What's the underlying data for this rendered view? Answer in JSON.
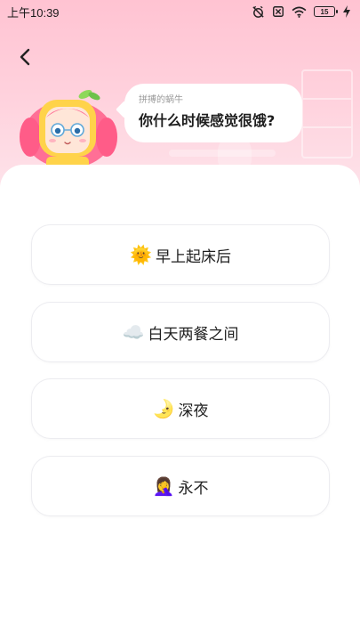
{
  "status_bar": {
    "time": "上午10:39",
    "battery": "15"
  },
  "header": {
    "back_icon": "chevron-left-icon"
  },
  "bubble": {
    "author": "拼搏的蜗牛",
    "question": "你什么时候感觉很饿?"
  },
  "options": [
    {
      "emoji": "🌞",
      "label": "早上起床后"
    },
    {
      "emoji": "☁️",
      "label": "白天两餐之间"
    },
    {
      "emoji": "🌛",
      "label": "深夜"
    },
    {
      "emoji": "🤦‍♀️",
      "label": "永不"
    }
  ],
  "colors": {
    "header_pink": "#ffc3d2",
    "text_dark": "#1e1e1e",
    "border": "#ececf0"
  }
}
